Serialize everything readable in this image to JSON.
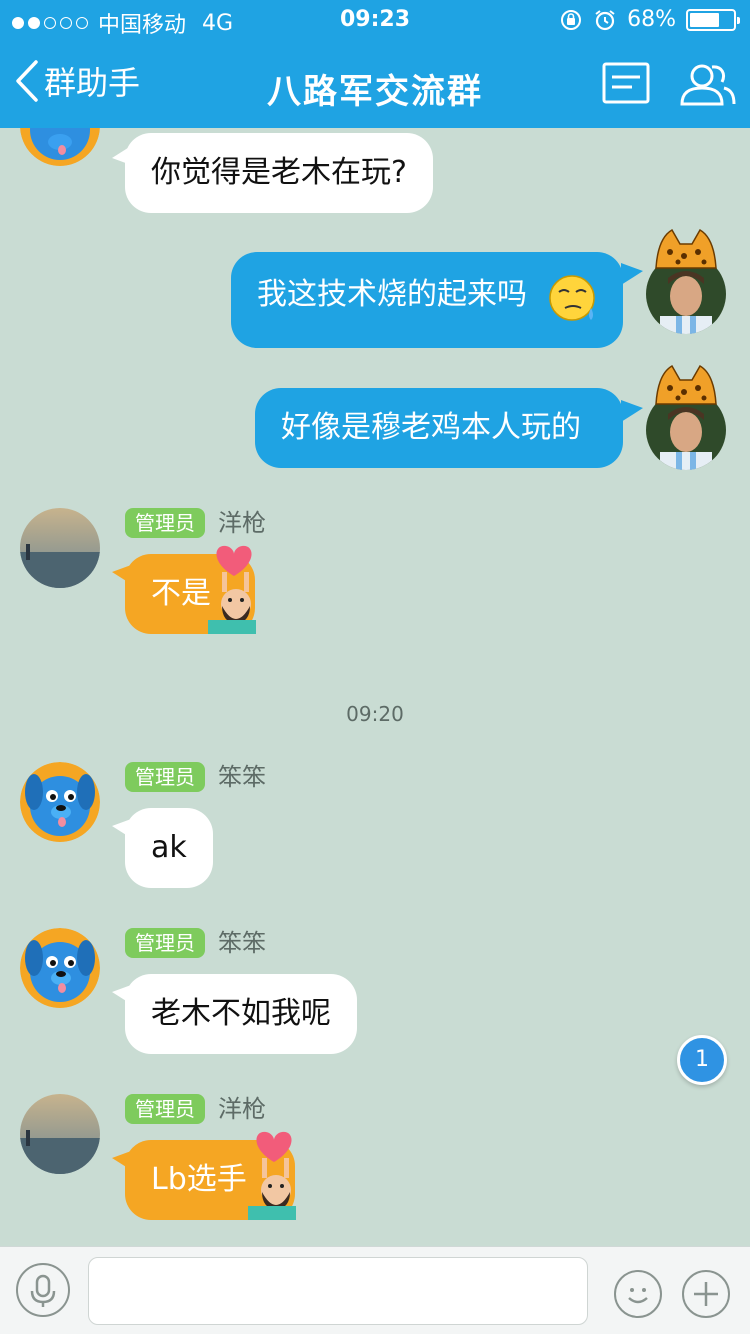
{
  "status_bar": {
    "carrier": "中国移动",
    "network": "4G",
    "time": "09:23",
    "battery": "68%",
    "battery_level": 0.68
  },
  "nav": {
    "back_label": "群助手",
    "title": "八路军交流群"
  },
  "messages": [
    {
      "side": "left",
      "text": "你觉得是老木在玩?"
    },
    {
      "side": "right",
      "text": "我这技术烧的起来吗"
    },
    {
      "side": "right",
      "text": "好像是穆老鸡本人玩的"
    },
    {
      "side": "left",
      "badge": "管理员",
      "sender": "洋枪",
      "text": "不是"
    },
    {
      "side": "left",
      "badge": "管理员",
      "sender": "笨笨",
      "text": "ak"
    },
    {
      "side": "left",
      "badge": "管理员",
      "sender": "笨笨",
      "text": "老木不如我呢"
    },
    {
      "side": "left",
      "badge": "管理员",
      "sender": "洋枪",
      "text": "Lb选手"
    }
  ],
  "timestamp": "09:20",
  "unread_count": "1",
  "colors": {
    "header": "#1fa3e3",
    "chat_bg": "#c9dcd3",
    "bubble_blue": "#1fa3e3",
    "bubble_orange": "#f5a623",
    "badge_green": "#7ecb5d"
  }
}
